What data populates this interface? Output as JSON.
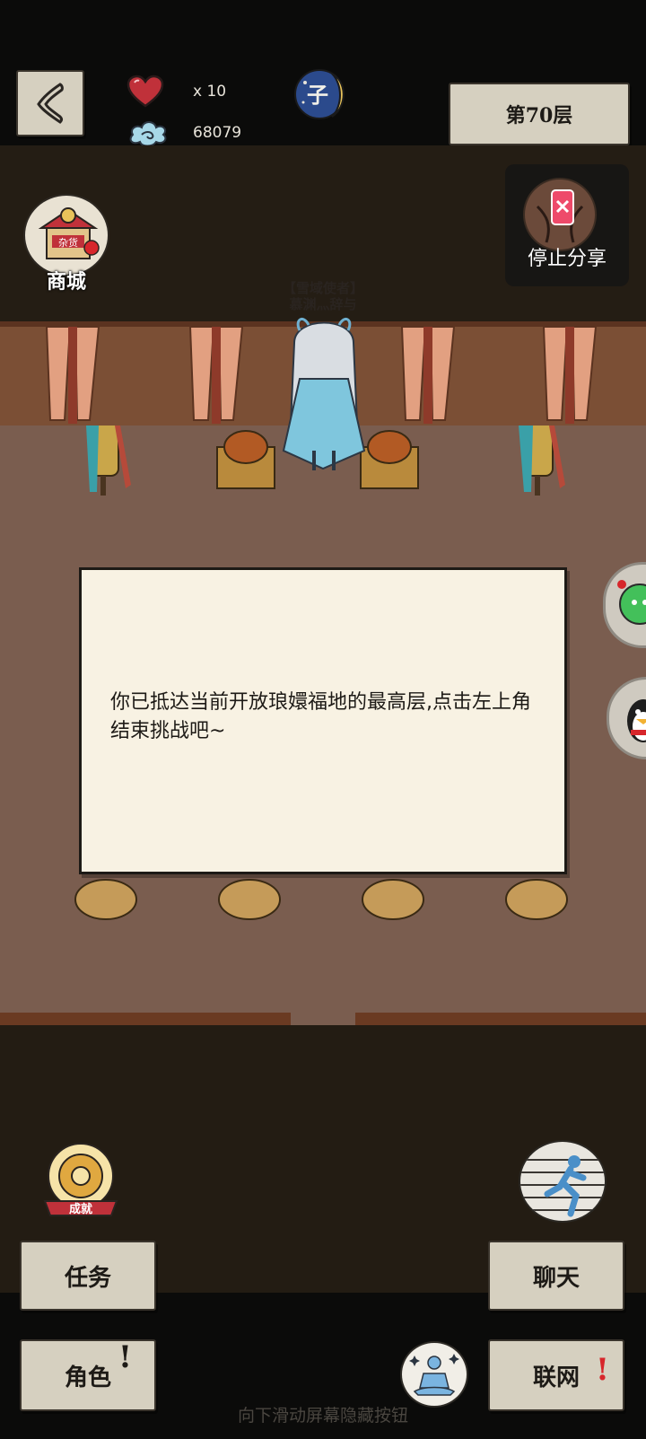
{
  "topbar": {
    "lives_text": "x 10",
    "coins_text": "68079",
    "time_badge": "子",
    "floor_label": "第70层"
  },
  "shop": {
    "label": "商城",
    "sign_text": "杂货"
  },
  "share": {
    "label": "停止分享"
  },
  "npc": {
    "title_line1": "【雪域使者】",
    "title_line2": "慕渊灬辞与"
  },
  "dialog": {
    "text": "你已抵达当前开放琅嬛福地的最高层,点击左上角结束挑战吧~"
  },
  "achievement": {
    "label": "成就"
  },
  "menu": {
    "task_label": "任务",
    "role_label": "角色",
    "chat_label": "聊天",
    "net_label": "联网",
    "exclaim": "!"
  },
  "hint": "向下滑动屏幕隐藏按钮",
  "colors": {
    "paper": "#d6d0c0",
    "dialog_bg": "#f8f2e3",
    "alert_red": "#d7262b",
    "floor": "#7a5d4f",
    "wall": "#7b4f35"
  }
}
